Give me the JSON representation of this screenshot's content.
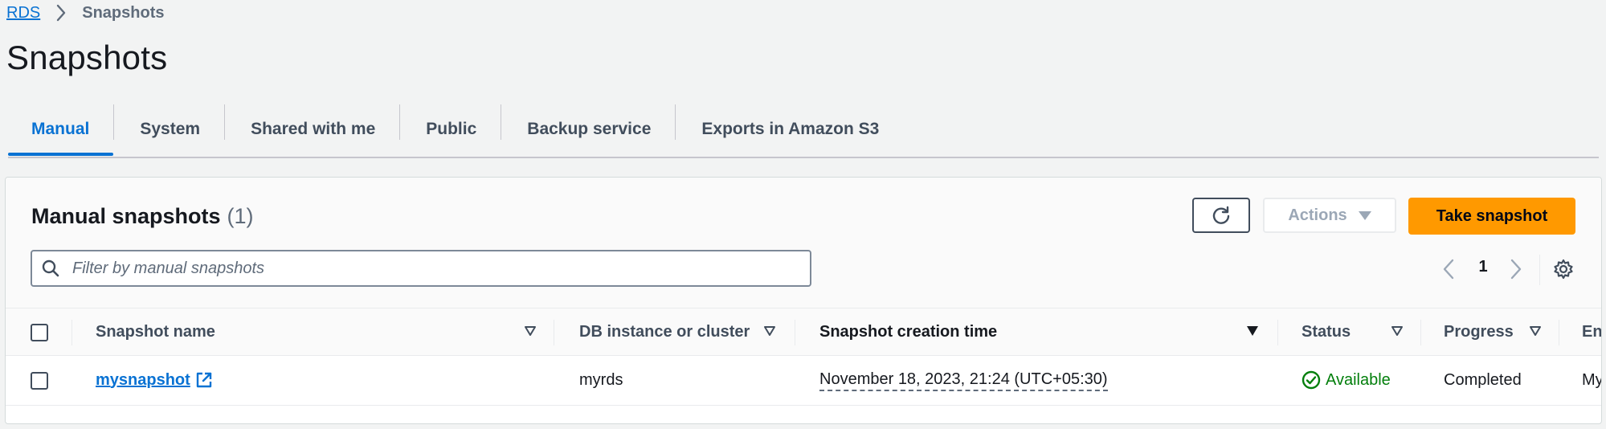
{
  "breadcrumb": {
    "root": "RDS",
    "current": "Snapshots"
  },
  "page": {
    "title": "Snapshots"
  },
  "tabs": [
    {
      "label": "Manual",
      "active": true
    },
    {
      "label": "System",
      "active": false
    },
    {
      "label": "Shared with me",
      "active": false
    },
    {
      "label": "Public",
      "active": false
    },
    {
      "label": "Backup service",
      "active": false
    },
    {
      "label": "Exports in Amazon S3",
      "active": false
    }
  ],
  "panel": {
    "title": "Manual snapshots",
    "count": "(1)",
    "refresh_icon": "refresh-icon",
    "actions_label": "Actions",
    "primary_label": "Take snapshot",
    "filter_placeholder": "Filter by manual snapshots",
    "page_number": "1"
  },
  "table": {
    "columns": [
      "Snapshot name",
      "DB instance or cluster",
      "Snapshot creation time",
      "Status",
      "Progress",
      "En"
    ],
    "rows": [
      {
        "name": "mysnapshot",
        "db_instance": "myrds",
        "created": "November 18, 2023, 21:24 (UTC+05:30)",
        "status": "Available",
        "progress": "Completed",
        "engine": "My"
      }
    ]
  },
  "colors": {
    "accent": "#0972d3",
    "primary_button": "#ff9900",
    "success": "#037f0c"
  }
}
